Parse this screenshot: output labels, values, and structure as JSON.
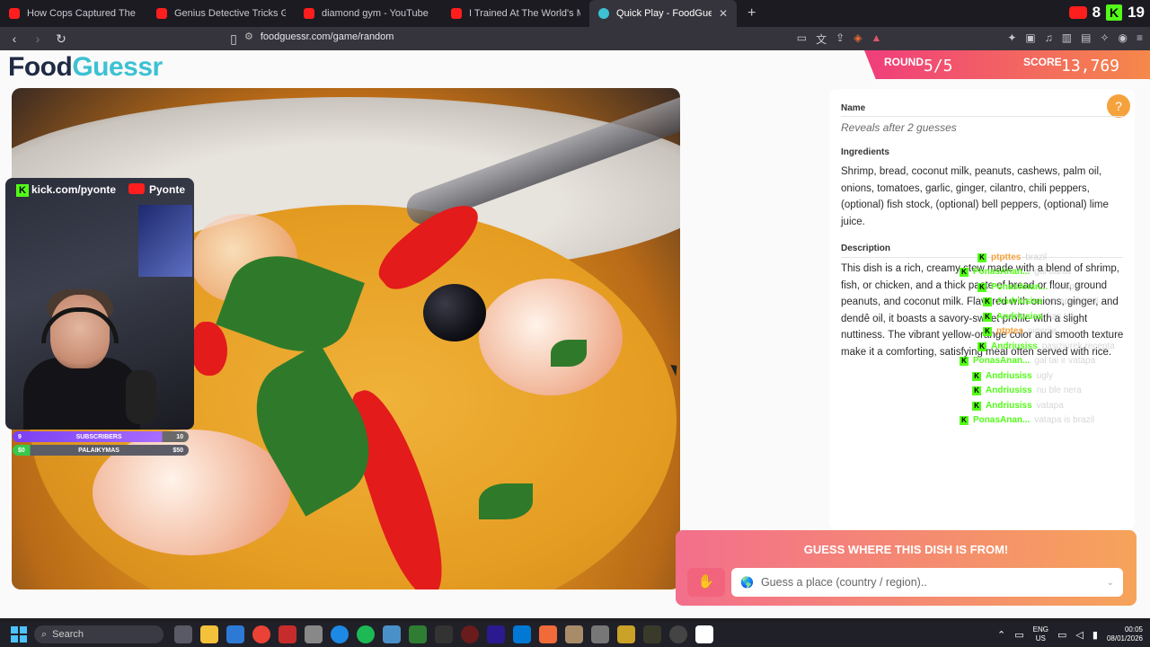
{
  "browser": {
    "tabs": [
      {
        "title": "How Cops Captured The Minnesota",
        "kind": "yt",
        "active": false
      },
      {
        "title": "Genius Detective Tricks Guilty Suspe",
        "kind": "yt",
        "active": false
      },
      {
        "title": "diamond gym - YouTube",
        "kind": "yt",
        "active": false
      },
      {
        "title": "I Trained At The World's Most Dange",
        "kind": "yt",
        "active": false
      },
      {
        "title": "Quick Play - FoodGuessr | Food",
        "kind": "fg",
        "active": true
      }
    ],
    "url": "foodguessr.com/game/random",
    "youtube_count": "8",
    "kick_count": "19"
  },
  "game": {
    "logo_part1": "Food",
    "logo_part2": "Guessr",
    "round_label": "ROUND",
    "round_value": "5/5",
    "score_label": "SCORE",
    "score_value": "13,769"
  },
  "stream": {
    "kick_handle": "kick.com/pyonte",
    "youtube_handle": "Pyonte",
    "subscribers_label": "SUBSCRIBERS",
    "subscribers_current": "9",
    "subscribers_goal": "10",
    "palaikymas_label": "PALAIKYMAS",
    "palaikymas_current": "$0",
    "palaikymas_goal": "$50"
  },
  "card": {
    "name_label": "Name",
    "name_value": "Reveals after 2 guesses",
    "ingredients_label": "Ingredients",
    "ingredients_text": "Shrimp, bread, coconut milk, peanuts, cashews, palm oil, onions, tomatoes, garlic, ginger, cilantro, chili peppers, (optional) fish stock, (optional) bell peppers, (optional) lime juice.",
    "description_label": "Description",
    "description_text": "This dish is a rich, creamy stew made with a blend of shrimp, fish, or chicken, and a thick paste of bread or flour, ground peanuts, and coconut milk. Flavored with onions, ginger, and dendê oil, it boasts a savory-sweet profile with a slight nuttiness. The vibrant yellow-orange color and smooth texture make it a comforting, satisfying meal often served with rice."
  },
  "chat": [
    {
      "user": "ptpttes",
      "color": "#f5a23c",
      "msg": "brazil"
    },
    {
      "user": "PonasAnan...",
      "color": "#53fc18",
      "msg": "gal bahia"
    },
    {
      "user": "PonasAnan...",
      "color": "#53fc18",
      "msg": "vatapa"
    },
    {
      "user": "Andriusiss",
      "color": "#53fc18",
      "msg": "vatapa brazil"
    },
    {
      "user": "Andriusiss",
      "color": "#53fc18",
      "msg": "kas tai"
    },
    {
      "user": "ptptes",
      "color": "#f5a23c",
      "msg": "nigerija"
    },
    {
      "user": "Andriusiss",
      "color": "#53fc18",
      "msg": "pasiziurek recepta"
    },
    {
      "user": "PonasAnan...",
      "color": "#53fc18",
      "msg": "gal tai ir vatapa"
    },
    {
      "user": "Andriusiss",
      "color": "#53fc18",
      "msg": "ugly"
    },
    {
      "user": "Andriusiss",
      "color": "#53fc18",
      "msg": "nu ble nera"
    },
    {
      "user": "Andriusiss",
      "color": "#53fc18",
      "msg": "vatapa"
    },
    {
      "user": "PonasAnan...",
      "color": "#53fc18",
      "msg": "vatapa is brazil"
    }
  ],
  "guess": {
    "title": "GUESS WHERE THIS DISH IS FROM!",
    "placeholder": "Guess a place (country / region).."
  },
  "taskbar": {
    "search_label": "Search",
    "lang_top": "ENG",
    "lang_bottom": "US",
    "time": "00:05",
    "date": "08/01/2026"
  }
}
